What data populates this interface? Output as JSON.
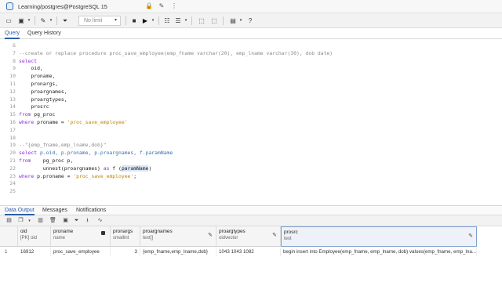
{
  "window": {
    "title": "Learning/postgres@PostgreSQL 15"
  },
  "toolbar": {
    "limit_value": "No limit"
  },
  "tabs": [
    "Query",
    "Query History"
  ],
  "editor": {
    "lines": [
      {
        "n": "6",
        "tokens": []
      },
      {
        "n": "7",
        "tokens": [
          {
            "t": "--create or replace procedure proc_save_employee(emp_fname varchar(20), emp_lname varchar(30), dob date)",
            "c": "comment"
          }
        ]
      },
      {
        "n": "8",
        "tokens": [
          {
            "t": "select",
            "c": "kw"
          }
        ]
      },
      {
        "n": "9",
        "tokens": [
          {
            "t": "    oid,",
            "c": "fn"
          }
        ]
      },
      {
        "n": "10",
        "tokens": [
          {
            "t": "    proname,",
            "c": "fn"
          }
        ]
      },
      {
        "n": "11",
        "tokens": [
          {
            "t": "    pronargs,",
            "c": "fn"
          }
        ]
      },
      {
        "n": "12",
        "tokens": [
          {
            "t": "    proargnames,",
            "c": "fn"
          }
        ]
      },
      {
        "n": "13",
        "tokens": [
          {
            "t": "    proargtypes,",
            "c": "fn"
          }
        ]
      },
      {
        "n": "14",
        "tokens": [
          {
            "t": "    prosrc",
            "c": "fn"
          }
        ]
      },
      {
        "n": "15",
        "tokens": [
          {
            "t": "from",
            "c": "kw"
          },
          {
            "t": " pg_proc",
            "c": "fn"
          }
        ]
      },
      {
        "n": "16",
        "tokens": [
          {
            "t": "where",
            "c": "kw"
          },
          {
            "t": " proname = ",
            "c": "fn"
          },
          {
            "t": "'proc_save_employee'",
            "c": "str"
          }
        ]
      },
      {
        "n": "17",
        "tokens": []
      },
      {
        "n": "18",
        "tokens": []
      },
      {
        "n": "19",
        "tokens": [
          {
            "t": "--\"{emp_fname,emp_lname,dob}\"",
            "c": "comment"
          }
        ]
      },
      {
        "n": "20",
        "tokens": [
          {
            "t": "select",
            "c": "kw"
          },
          {
            "t": " p.oid, p.proname, p.proargnames, f.paramName",
            "c": "id"
          }
        ]
      },
      {
        "n": "21",
        "tokens": [
          {
            "t": "from",
            "c": "kw"
          },
          {
            "t": "    pg_proc p,",
            "c": "fn"
          }
        ]
      },
      {
        "n": "22",
        "tokens": [
          {
            "t": "        unnest(proargnames) ",
            "c": "fn"
          },
          {
            "t": "as",
            "c": "kw"
          },
          {
            "t": " f (",
            "c": "fn"
          },
          {
            "t": "paramName",
            "c": "hl"
          },
          {
            "t": ")",
            "c": "fn"
          }
        ]
      },
      {
        "n": "23",
        "tokens": [
          {
            "t": "where",
            "c": "kw"
          },
          {
            "t": " p.proname = ",
            "c": "fn"
          },
          {
            "t": "'proc_save_employee'",
            "c": "str"
          },
          {
            "t": ";",
            "c": "fn"
          }
        ]
      },
      {
        "n": "24",
        "tokens": []
      },
      {
        "n": "25",
        "tokens": []
      }
    ]
  },
  "bottom_tabs": [
    "Data Output",
    "Messages",
    "Notifications"
  ],
  "results": {
    "columns": [
      {
        "name": "oid",
        "type": "[PK] oid"
      },
      {
        "name": "proname",
        "type": "name"
      },
      {
        "name": "pronargs",
        "type": "smallint"
      },
      {
        "name": "proargnames",
        "type": "text[]"
      },
      {
        "name": "proargtypes",
        "type": "oidvector"
      },
      {
        "name": "prosrc",
        "type": "text"
      }
    ],
    "rows": [
      {
        "rownum": "1",
        "cells": [
          "16912",
          "proc_save_employee",
          "3",
          "{emp_fname,emp_lname,dob}",
          "1043 1043 1082",
          "begin insert into Employee(emp_fname, emp_lname, dob) values(emp_fname, emp_lna..."
        ]
      }
    ]
  }
}
